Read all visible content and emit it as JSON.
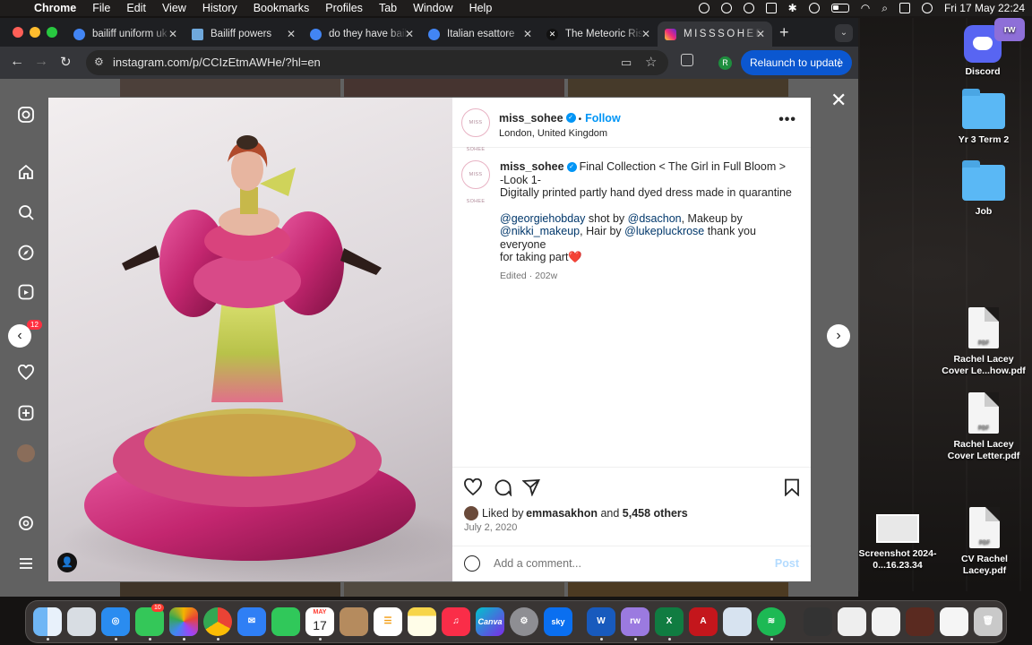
{
  "menubar": {
    "app": "Chrome",
    "items": [
      "File",
      "Edit",
      "View",
      "History",
      "Bookmarks",
      "Profiles",
      "Tab",
      "Window",
      "Help"
    ],
    "clock": "Fri 17 May  22:24"
  },
  "tabs": [
    {
      "title": "bailiff uniform uk",
      "color": "#4285f4"
    },
    {
      "title": "Bailiff powers",
      "color": "#6fa8dc"
    },
    {
      "title": "do they have bailiff",
      "color": "#4285f4"
    },
    {
      "title": "Italian esattore",
      "color": "#4285f4"
    },
    {
      "title": "The Meteoric Rise",
      "color": "#111111"
    },
    {
      "title": "MISSSOHEE",
      "color": "#e1306c"
    }
  ],
  "toolbar": {
    "url": "instagram.com/p/CCIzEtmAWHe/?hl=en",
    "profile_initial": "R",
    "relaunch_label": "Relaunch to update"
  },
  "instagram": {
    "notification_count": "12",
    "post": {
      "username": "miss_sohee",
      "avatar_text": "MISS SOHEE",
      "follow_label": "Follow",
      "location": "London, United Kingdom",
      "caption_lines": [
        "Final Collection < The Girl in Full Bloom >",
        "-Look 1-",
        "Digitally printed partly hand dyed dress made in quarantine"
      ],
      "credits": {
        "m1": "@georgiehobday",
        "t1": " shot by ",
        "m2": "@dsachon",
        "t2": ", Makeup by",
        "m3": "@nikki_makeup",
        "t3": ", Hair by ",
        "m4": "@lukepluckrose",
        "t4": " thank you everyone",
        "t5": "for taking part❤️"
      },
      "edited": "Edited · 202w",
      "liked_by_prefix": "Liked by ",
      "liked_by_user": "emmasakhon",
      "liked_by_and": " and ",
      "liked_by_others": "5,458 others",
      "date": "July 2, 2020",
      "comment_placeholder": "Add a comment...",
      "post_label": "Post"
    }
  },
  "desktop": {
    "icons": [
      {
        "name": "Discord",
        "type": "app"
      },
      {
        "name": "Yr 3 Term 2",
        "type": "folder"
      },
      {
        "name": "Job",
        "type": "folder"
      },
      {
        "name": "Rachel Lacey Cover Le...how.pdf",
        "type": "pdf"
      },
      {
        "name": "Rachel Lacey Cover Letter.pdf",
        "type": "pdf"
      },
      {
        "name": "Screenshot 2024-0...16.23.34",
        "type": "screenshot"
      },
      {
        "name": "CV Rachel Lacey.pdf",
        "type": "pdf"
      }
    ],
    "pdf_label": "PDF"
  },
  "dock": {
    "messages_badge": "10",
    "calendar_month": "MAY",
    "calendar_day": "17",
    "apps": [
      "Finder",
      "Launchpad",
      "Safari",
      "Messages",
      "Photos",
      "Chrome",
      "Mail",
      "FaceTime",
      "Calendar",
      "Contacts",
      "Reminders",
      "Notes",
      "Music",
      "Canva",
      "System Settings",
      "Sky Go",
      "Word",
      "RW",
      "Excel",
      "Acrobat",
      "Preview",
      "Spotify"
    ]
  }
}
